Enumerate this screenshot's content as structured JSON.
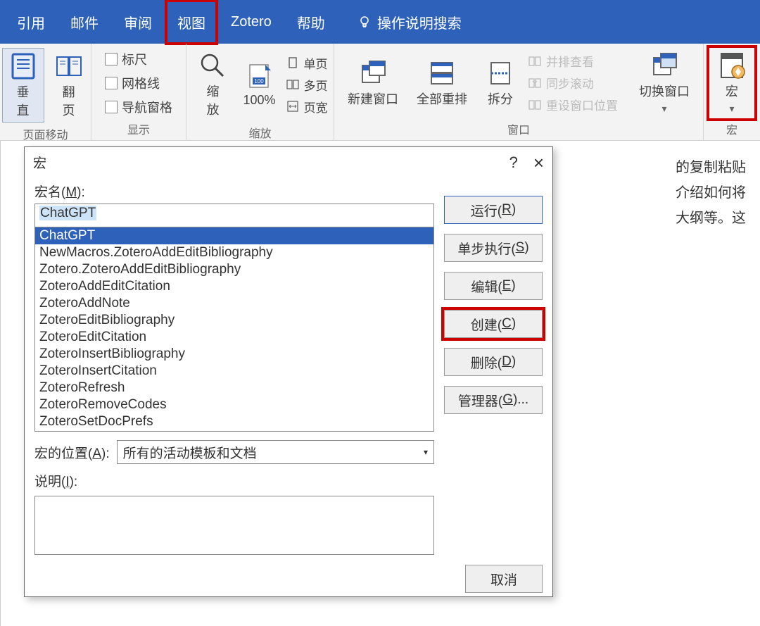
{
  "tabs": {
    "ref": "引用",
    "mail": "邮件",
    "review": "审阅",
    "view": "视图",
    "zotero": "Zotero",
    "help": "帮助",
    "tellme": "操作说明搜索"
  },
  "ribbon": {
    "pagemove": {
      "vertical": "垂\n直",
      "flip": "翻\n页",
      "group": "页面移动"
    },
    "show": {
      "ruler": "标尺",
      "grid": "网格线",
      "nav": "导航窗格",
      "group": "显示"
    },
    "zoom": {
      "zoom": "缩\n放",
      "p100": "100%",
      "one": "单页",
      "multi": "多页",
      "pgw": "页宽",
      "group": "缩放"
    },
    "window": {
      "neww": "新建窗口",
      "arrange": "全部重排",
      "split": "拆分",
      "side": "并排查看",
      "sync": "同步滚动",
      "reset": "重设窗口位置",
      "switch": "切换窗口",
      "group": "窗口"
    },
    "macro": {
      "macro": "宏",
      "group": "宏"
    }
  },
  "doc": {
    "l1": "的复制粘贴",
    "l2": "介绍如何将",
    "l3": "大纲等。这"
  },
  "dialog": {
    "title": "宏",
    "name_label_pre": "宏名(",
    "name_label_key": "M",
    "name_label_post": "):",
    "name_value": "ChatGPT",
    "list": [
      "ChatGPT",
      "NewMacros.ZoteroAddEditBibliography",
      "Zotero.ZoteroAddEditBibliography",
      "ZoteroAddEditCitation",
      "ZoteroAddNote",
      "ZoteroEditBibliography",
      "ZoteroEditCitation",
      "ZoteroInsertBibliography",
      "ZoteroInsertCitation",
      "ZoteroRefresh",
      "ZoteroRemoveCodes",
      "ZoteroSetDocPrefs"
    ],
    "loc_label_pre": "宏的位置(",
    "loc_label_key": "A",
    "loc_label_post": "):",
    "loc_value": "所有的活动模板和文档",
    "desc_label_pre": "说明(",
    "desc_label_key": "I",
    "desc_label_post": "):",
    "buttons": {
      "run_pre": "运行(",
      "run_key": "R",
      "run_post": ")",
      "step_pre": "单步执行(",
      "step_key": "S",
      "step_post": ")",
      "edit_pre": "编辑(",
      "edit_key": "E",
      "edit_post": ")",
      "create_pre": "创建(",
      "create_key": "C",
      "create_post": ")",
      "del_pre": "删除(",
      "del_key": "D",
      "del_post": ")",
      "org_pre": "管理器(",
      "org_key": "G",
      "org_post": ")..."
    },
    "cancel": "取消",
    "help": "?",
    "close": "×"
  }
}
